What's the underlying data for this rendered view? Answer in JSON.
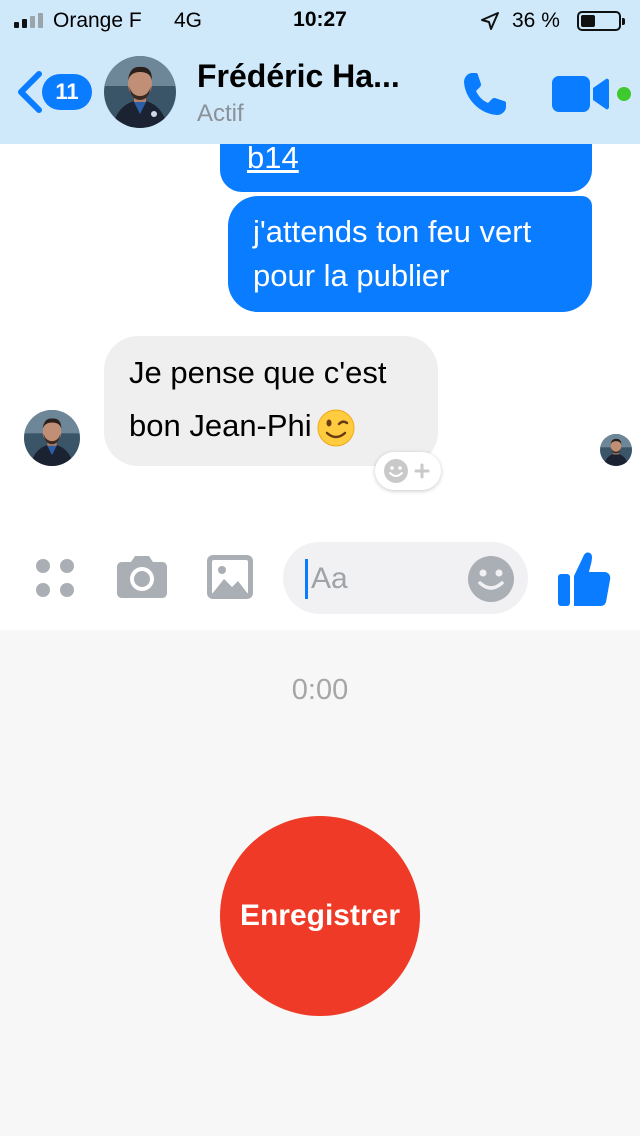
{
  "status_bar": {
    "carrier": "Orange F",
    "network": "4G",
    "time": "10:27",
    "battery_percent": "36 %",
    "signal_bars_filled": 2,
    "signal_bars_total": 4
  },
  "header": {
    "back_badge": "11",
    "contact_name": "Frédéric Ha...",
    "contact_status": "Actif",
    "online": true
  },
  "conversation": {
    "messages": [
      {
        "direction": "sent",
        "text": "b14"
      },
      {
        "direction": "sent",
        "lines": [
          "j'attends ton feu vert",
          "pour la publier"
        ]
      },
      {
        "direction": "received",
        "lines": [
          "Je pense que c'est",
          "bon Jean-Phi"
        ],
        "emoji": "winking-face"
      }
    ]
  },
  "composer": {
    "placeholder": "Aa"
  },
  "voice_recorder": {
    "timer": "0:00",
    "record_label": "Enregistrer"
  },
  "colors": {
    "messenger_blue": "#0a7cff",
    "record_red": "#ee3a26",
    "online_green": "#3ec92d",
    "header_bg": "#cfe9fb"
  }
}
